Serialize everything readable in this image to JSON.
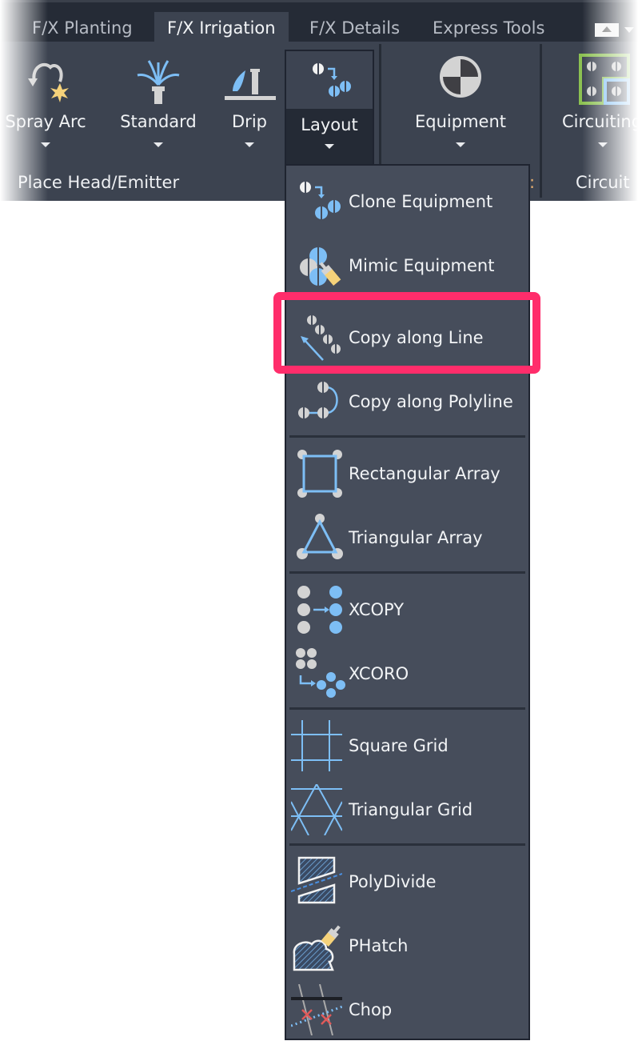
{
  "ribbon": {
    "tabs": [
      {
        "label": "F/X Planting",
        "active": false
      },
      {
        "label": "F/X Irrigation",
        "active": true
      },
      {
        "label": "F/X Details",
        "active": false
      },
      {
        "label": "Express Tools",
        "active": false
      }
    ],
    "buttons": [
      {
        "label": "Spray Arc",
        "icon": "spray-arc-icon"
      },
      {
        "label": "Standard",
        "icon": "standard-head-icon"
      },
      {
        "label": "Drip",
        "icon": "drip-icon"
      },
      {
        "label": "Layout",
        "icon": "layout-icon",
        "open": true
      },
      {
        "label": "Equipment",
        "icon": "equipment-icon"
      },
      {
        "label": "Circuiting",
        "icon": "circuiting-icon"
      }
    ],
    "groups": {
      "place_head": "Place Head/Emitter",
      "equipment_partial": ":",
      "circuit": "Circuit"
    }
  },
  "layout_menu": {
    "items": [
      {
        "label": "Clone Equipment",
        "icon": "clone-equipment-icon"
      },
      {
        "label": "Mimic Equipment",
        "icon": "mimic-equipment-icon"
      },
      {
        "label": "Copy along Line",
        "icon": "copy-along-line-icon",
        "highlighted": true
      },
      {
        "label": "Copy along Polyline",
        "icon": "copy-along-polyline-icon"
      },
      {
        "label": "Rectangular Array",
        "icon": "rectangular-array-icon"
      },
      {
        "label": "Triangular Array",
        "icon": "triangular-array-icon"
      },
      {
        "label": "XCOPY",
        "icon": "xcopy-icon"
      },
      {
        "label": "XCORO",
        "icon": "xcoro-icon"
      },
      {
        "label": "Square Grid",
        "icon": "square-grid-icon"
      },
      {
        "label": "Triangular Grid",
        "icon": "triangular-grid-icon"
      },
      {
        "label": "PolyDivide",
        "icon": "polydivide-icon"
      },
      {
        "label": "PHatch",
        "icon": "phatch-icon"
      },
      {
        "label": "Chop",
        "icon": "chop-icon"
      }
    ]
  },
  "colors": {
    "highlight": "#ff2d6b",
    "accent_blue": "#7dbef5",
    "accent_green": "#8cc152",
    "accent_yellow": "#f5d27a"
  }
}
